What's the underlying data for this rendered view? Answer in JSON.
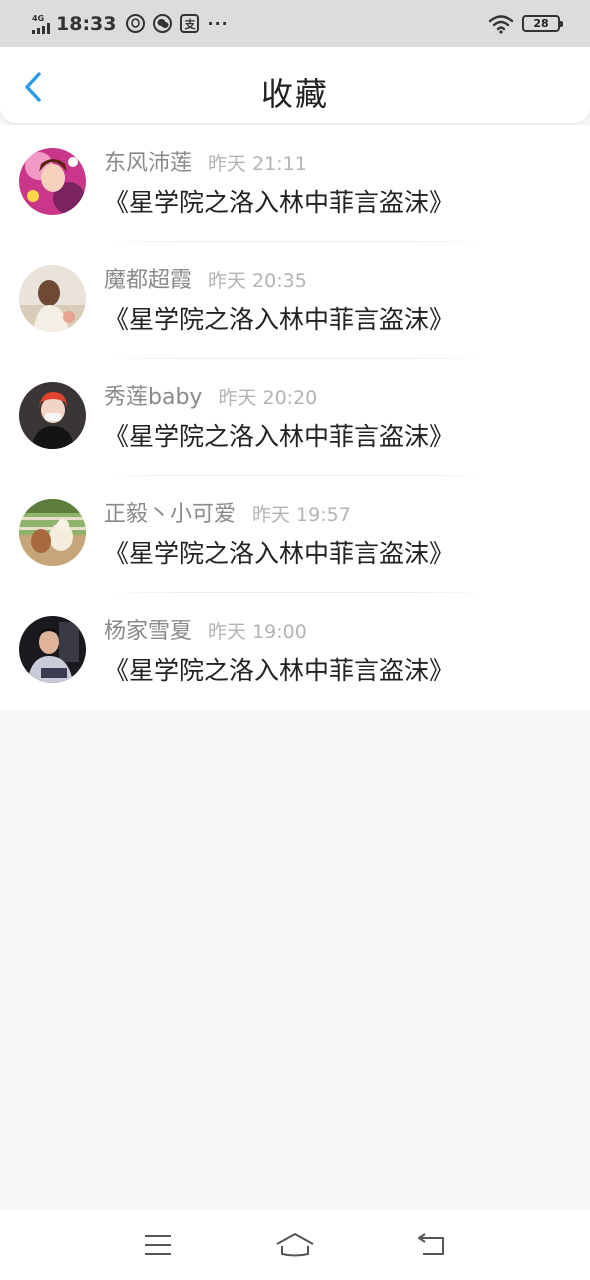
{
  "status_bar": {
    "network": "4G",
    "time": "18:33",
    "icons": [
      "qq-icon",
      "wechat-icon",
      "alipay-icon"
    ],
    "alipay_glyph": "支",
    "more": "···",
    "battery": "28"
  },
  "header": {
    "title": "收藏",
    "back_icon": "chevron-left-icon",
    "accent_color": "#2a9be6"
  },
  "favorites": [
    {
      "name": "东风沛莲",
      "time": "昨天 21:11",
      "content": "《星学院之洛入林中菲言盗沫》"
    },
    {
      "name": "魔都超霞",
      "time": "昨天 20:35",
      "content": "《星学院之洛入林中菲言盗沫》"
    },
    {
      "name": "秀莲baby",
      "time": "昨天 20:20",
      "content": "《星学院之洛入林中菲言盗沫》"
    },
    {
      "name": "正毅丶小可爱",
      "time": "昨天 19:57",
      "content": "《星学院之洛入林中菲言盗沫》"
    },
    {
      "name": "杨家雪夏",
      "time": "昨天 19:00",
      "content": "《星学院之洛入林中菲言盗沫》"
    }
  ],
  "nav": {
    "icons": [
      "menu-icon",
      "home-icon",
      "back-arrow-icon"
    ]
  }
}
